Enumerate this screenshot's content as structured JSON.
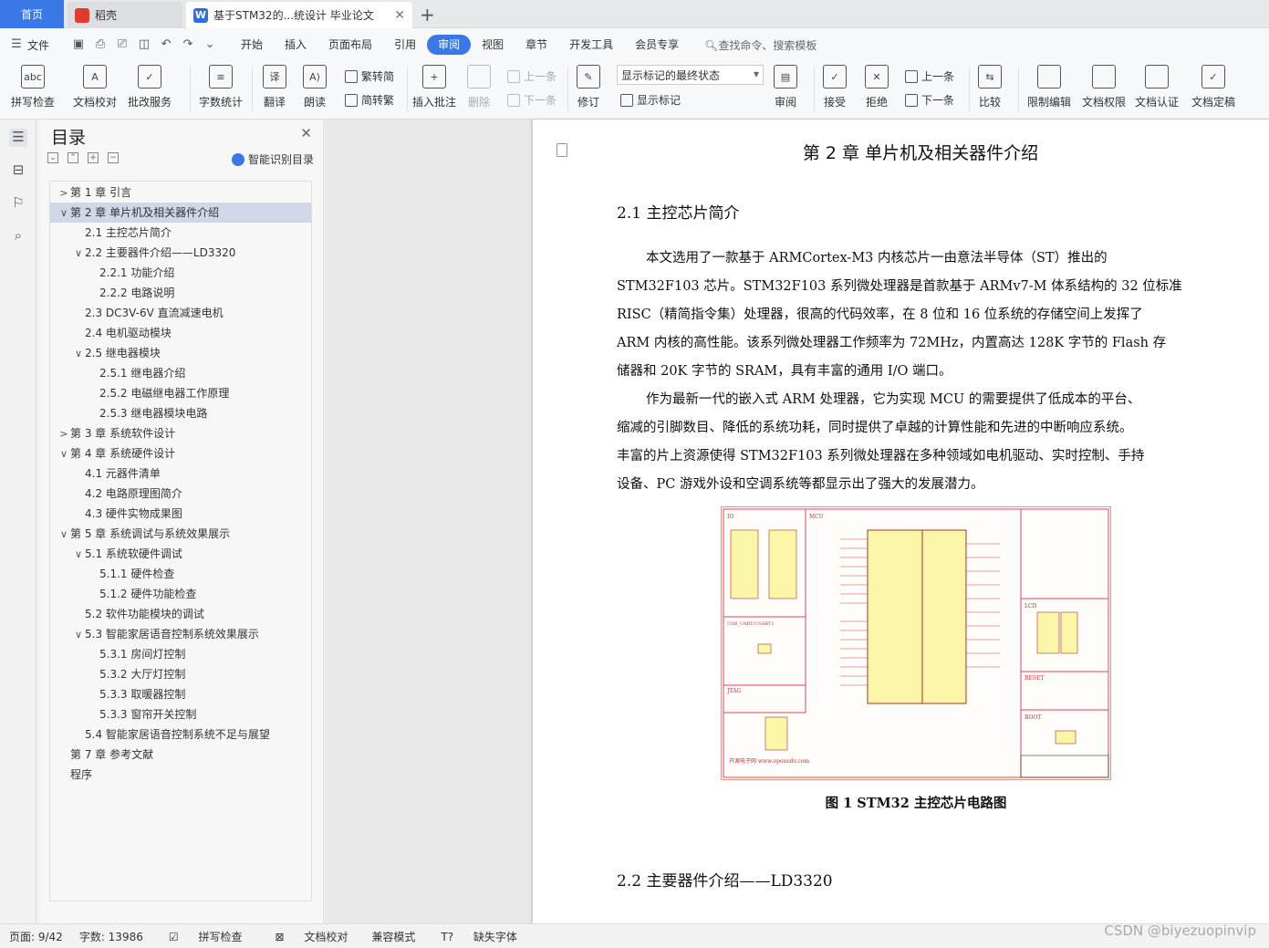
{
  "tabs": {
    "home": "首页",
    "daoke": "稻壳",
    "doc": "基于STM32的...统设计 毕业论文"
  },
  "menu": {
    "file": "文件",
    "items": [
      "开始",
      "插入",
      "页面布局",
      "引用",
      "审阅",
      "视图",
      "章节",
      "开发工具",
      "会员专享"
    ],
    "active": "审阅",
    "search": "查找命令、搜索模板"
  },
  "ribbon": {
    "spell": "拼写检查",
    "proof": "文档校对",
    "revise_service": "批改服务",
    "word_count": "字数统计",
    "translate": "翻译",
    "read": "朗读",
    "trad": "繁转简",
    "simp": "简转繁",
    "insert_comment": "插入批注",
    "delete": "删除",
    "prev": "上一条",
    "next": "下一条",
    "track": "修订",
    "display_select": "显示标记的最终状态",
    "show_markup": "显示标记",
    "review": "审阅",
    "accept": "接受",
    "reject": "拒绝",
    "prev2": "上一条",
    "next2": "下一条",
    "compare": "比较",
    "restrict": "限制编辑",
    "permission": "文档权限",
    "cert": "文档认证",
    "finalize": "文档定稿"
  },
  "toc": {
    "title": "目录",
    "smart": "智能识别目录",
    "items": [
      {
        "text": "第 1 章  引言",
        "level": 0,
        "arrow": "›"
      },
      {
        "text": "第 2 章  单片机及相关器件介绍",
        "level": 0,
        "arrow": "⌄"
      },
      {
        "text": "2.1  主控芯片简介",
        "level": 1,
        "arrow": ""
      },
      {
        "text": "2.2  主要器件介绍——LD3320",
        "level": 1,
        "arrow": "⌄"
      },
      {
        "text": "2.2.1  功能介绍",
        "level": 2,
        "arrow": ""
      },
      {
        "text": "2.2.2  电路说明",
        "level": 2,
        "arrow": ""
      },
      {
        "text": "2.3 DC3V-6V 直流减速电机",
        "level": 1,
        "arrow": ""
      },
      {
        "text": "2.4  电机驱动模块",
        "level": 1,
        "arrow": ""
      },
      {
        "text": "2.5  继电器模块",
        "level": 1,
        "arrow": "⌄"
      },
      {
        "text": "2.5.1  继电器介绍",
        "level": 2,
        "arrow": ""
      },
      {
        "text": "2.5.2  电磁继电器工作原理",
        "level": 2,
        "arrow": ""
      },
      {
        "text": "2.5.3  继电器模块电路",
        "level": 2,
        "arrow": ""
      },
      {
        "text": "第 3 章  系统软件设计",
        "level": 0,
        "arrow": "›"
      },
      {
        "text": "第 4 章  系统硬件设计",
        "level": 0,
        "arrow": "⌄"
      },
      {
        "text": "4.1  元器件清单",
        "level": 1,
        "arrow": ""
      },
      {
        "text": "4.2  电路原理图简介",
        "level": 1,
        "arrow": ""
      },
      {
        "text": "4.3 硬件实物成果图",
        "level": 1,
        "arrow": ""
      },
      {
        "text": "第 5 章  系统调试与系统效果展示",
        "level": 0,
        "arrow": "⌄"
      },
      {
        "text": "5.1  系统软硬件调试",
        "level": 1,
        "arrow": "⌄"
      },
      {
        "text": "5.1.1  硬件检查",
        "level": 2,
        "arrow": ""
      },
      {
        "text": "5.1.2  硬件功能检查",
        "level": 2,
        "arrow": ""
      },
      {
        "text": "5.2  软件功能模块的调试",
        "level": 1,
        "arrow": ""
      },
      {
        "text": "5.3  智能家居语音控制系统效果展示",
        "level": 1,
        "arrow": "⌄"
      },
      {
        "text": "5.3.1  房间灯控制",
        "level": 2,
        "arrow": ""
      },
      {
        "text": "5.3.2  大厅灯控制",
        "level": 2,
        "arrow": ""
      },
      {
        "text": "5.3.3  取暖器控制",
        "level": 2,
        "arrow": ""
      },
      {
        "text": "5.3.3  窗帘开关控制",
        "level": 2,
        "arrow": ""
      },
      {
        "text": "5.4  智能家居语音控制系统不足与展望",
        "level": 1,
        "arrow": ""
      },
      {
        "text": "第 7 章  参考文献",
        "level": 0,
        "arrow": ""
      },
      {
        "text": "程序",
        "level": 0,
        "arrow": ""
      }
    ]
  },
  "doc": {
    "chapter": "第 2 章  单片机及相关器件介绍",
    "sec1": "2.1  主控芯片简介",
    "para1_lines": [
      "本文选用了一款基于 ARMCortex-M3 内核芯片一由意法半导体（ST）推出的",
      "STM32F103 芯片。STM32F103 系列微处理器是首款基于 ARMv7-M 体系结构的 32 位标准",
      "RISC（精简指令集）处理器，很高的代码效率，在 8 位和 16 位系统的存储空间上发挥了",
      "ARM 内核的高性能。该系列微处理器工作频率为 72MHz，内置高达 128K 字节的 Flash 存",
      "储器和 20K 字节的 SRAM，具有丰富的通用 I/O 端口。"
    ],
    "para2_lines": [
      "作为最新一代的嵌入式 ARM 处理器，它为实现 MCU 的需要提供了低成本的平台、",
      "缩减的引脚数目、降低的系统功耗，同时提供了卓越的计算性能和先进的中断响应系统。",
      "丰富的片上资源使得 STM32F103 系列微处理器在多种领域如电机驱动、实时控制、手持",
      "设备、PC 游戏外设和空调系统等都显示出了强大的发展潜力。"
    ],
    "caption": "图 1 STM32 主控芯片电路图",
    "sec2": "2.2  主要器件介绍——LD3320",
    "fig_labels": {
      "io": "IO",
      "mcu": "MCU",
      "usb": "USB_UART/USART1",
      "jtag": "JTAG",
      "lcd": "LCD",
      "reset": "RESET",
      "boot": "BOOT",
      "site": "开源电子网  www.openedv.com"
    }
  },
  "status": {
    "page": "页面: 9/42",
    "words": "字数: 13986",
    "spell": "拼写检查",
    "proof": "文档校对",
    "compat": "兼容模式",
    "missing_font": "缺失字体"
  },
  "watermark": "CSDN @biyezuopinvip"
}
